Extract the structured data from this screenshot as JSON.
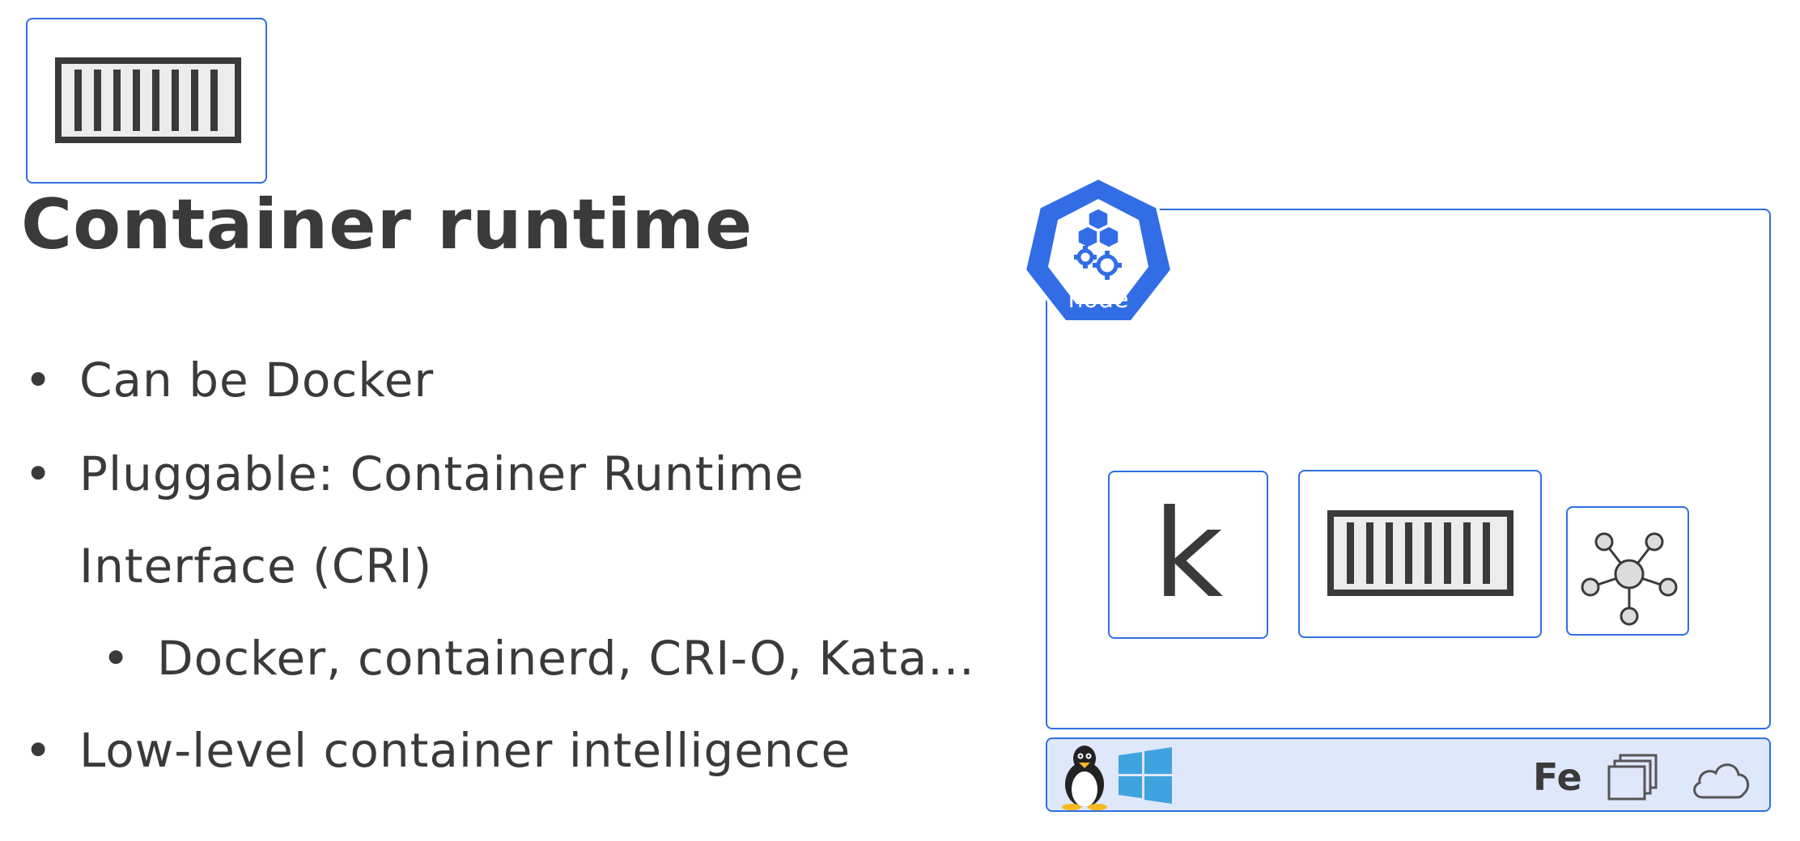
{
  "title": "Container runtime",
  "bullets": [
    {
      "text": "Can be Docker"
    },
    {
      "text": "Pluggable: Container Runtime"
    },
    {
      "text": "Interface (CRI)"
    },
    {
      "text": "Docker, containerd, CRI-O, Kata..."
    },
    {
      "text": "Low-level container intelligence"
    }
  ],
  "bullet_char": "•",
  "diagram": {
    "node_label": "node",
    "kubelet_letter": "k",
    "os_bar": {
      "fe_label": "Fe",
      "icons": [
        "linux-tux-icon",
        "windows-icon",
        "stacked-windows-icon",
        "cloud-icon"
      ]
    },
    "components": [
      "kubelet-icon",
      "container-runtime-icon",
      "kube-proxy-network-icon"
    ]
  },
  "colors": {
    "accent": "#2f6fe0",
    "k8s_blue": "#326de6",
    "text": "#3a3a3a",
    "os_bar_bg": "#dfe8fb",
    "windows_blue": "#3fa3e0"
  }
}
